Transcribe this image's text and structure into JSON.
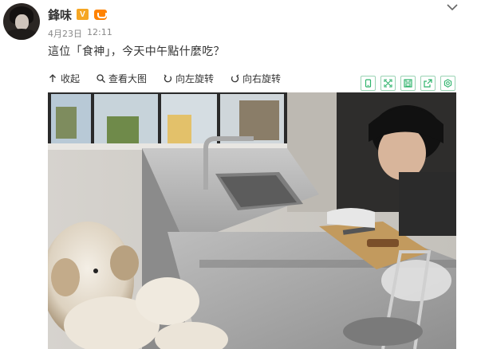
{
  "user": {
    "name": "鋒味",
    "verified_badge": "V"
  },
  "post": {
    "date": "4月23日",
    "time": "12:11",
    "text": "這位「食神」，今天中午點什麼吃？"
  },
  "media_toolbar": {
    "collapse": "收起",
    "view_large": "查看大图",
    "rotate_left": "向左旋转",
    "rotate_right": "向右旋转"
  },
  "icons": {
    "more": "chevron-down-icon",
    "collapse": "arrow-up-icon",
    "view_large": "magnifier-icon",
    "rotate_left": "rotate-left-icon",
    "rotate_right": "rotate-right-icon",
    "right_tools": [
      "phone-icon",
      "fullscreen-icon",
      "save-icon",
      "share-icon",
      "settings-icon"
    ]
  },
  "colors": {
    "vip": "#f5a623",
    "member": "#ff8200",
    "tool_border": "#9ad3b4",
    "tool_icon": "#2db36b"
  }
}
